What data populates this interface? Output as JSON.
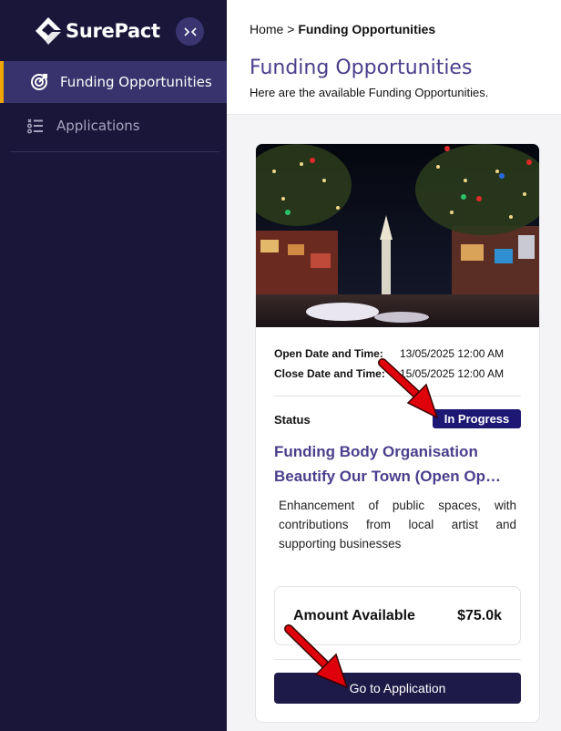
{
  "sidebar": {
    "brand": "SurePact",
    "items": [
      {
        "label": "Funding Opportunities",
        "icon": "target-icon",
        "active": true
      },
      {
        "label": "Applications",
        "icon": "checklist-icon",
        "active": false
      }
    ]
  },
  "header": {
    "breadcrumb": {
      "home": "Home",
      "separator": ">",
      "current": "Funding Opportunities"
    },
    "title": "Funding Opportunities",
    "subtitle": "Here are the available Funding Opportunities."
  },
  "card": {
    "open_label": "Open Date and Time:",
    "open_value": "13/05/2025 12:00 AM",
    "close_label": "Close Date and Time:",
    "close_value": "15/05/2025 12:00 AM",
    "status_label": "Status",
    "status_value": "In Progress",
    "title_line1": "Funding Body Organisation",
    "title_line2": "Beautify Our Town (Open Op…",
    "description": "Enhancement of public spaces, with contributions from local artist and supporting businesses",
    "amount_label": "Amount Available",
    "amount_value": "$75.0k",
    "button_label": "Go to Application"
  },
  "colors": {
    "sidebar_bg": "#19163a",
    "active_item_bg": "#38336c",
    "accent": "#f0a500",
    "title": "#4a3f8c",
    "badge": "#1d1874",
    "button": "#1e1a48",
    "annotation_arrow": "#e0000b"
  }
}
